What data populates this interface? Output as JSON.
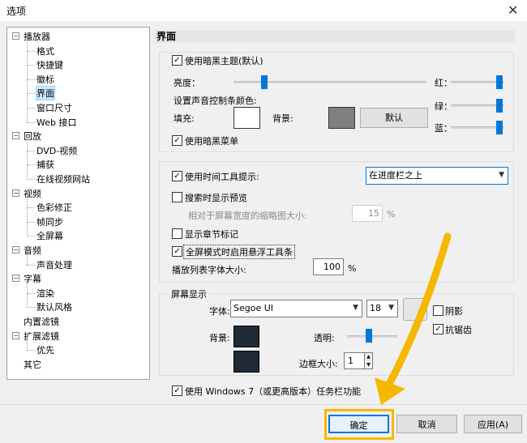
{
  "window": {
    "title": "选项",
    "close": "✕"
  },
  "tree": {
    "items": [
      {
        "label": "播放器",
        "level": 0,
        "expander": "−"
      },
      {
        "label": "格式",
        "level": 1
      },
      {
        "label": "快捷键",
        "level": 1
      },
      {
        "label": "徽标",
        "level": 1
      },
      {
        "label": "界面",
        "level": 1,
        "selected": true
      },
      {
        "label": "窗口尺寸",
        "level": 1
      },
      {
        "label": "Web 接口",
        "level": 1
      },
      {
        "label": "回放",
        "level": 0,
        "expander": "−"
      },
      {
        "label": "DVD-视频",
        "level": 1
      },
      {
        "label": "捕获",
        "level": 1
      },
      {
        "label": "在线视频网站",
        "level": 1
      },
      {
        "label": "视频",
        "level": 0,
        "expander": "−"
      },
      {
        "label": "色彩修正",
        "level": 1
      },
      {
        "label": "帧同步",
        "level": 1
      },
      {
        "label": "全屏幕",
        "level": 1
      },
      {
        "label": "音频",
        "level": 0,
        "expander": "−"
      },
      {
        "label": "声音处理",
        "level": 1
      },
      {
        "label": "字幕",
        "level": 0,
        "expander": "−"
      },
      {
        "label": "渲染",
        "level": 1
      },
      {
        "label": "默认风格",
        "level": 1
      },
      {
        "label": "内置滤镜",
        "level": 0
      },
      {
        "label": "扩展滤镜",
        "level": 0,
        "expander": "−"
      },
      {
        "label": "优先",
        "level": 1
      },
      {
        "label": "其它",
        "level": 0
      }
    ]
  },
  "panel": {
    "title": "界面",
    "theme": {
      "dark_theme_label": "使用暗黑主题(默认)",
      "dark_theme_checked": "✓",
      "brightness_label": "亮度：",
      "brightness_level": 0.16,
      "red_label": "红：",
      "green_label": "绿：",
      "blue_label": "蓝：",
      "red_level": 1.0,
      "green_level": 1.0,
      "blue_level": 1.0,
      "control_bar_color_label": "设置声音控制条颜色:",
      "fill_label": "填充:",
      "background_label": "背景:",
      "fill_color": "#ffffff",
      "background_color": "#808080",
      "default_button": "默认",
      "dark_menu_label": "使用暗黑菜单",
      "dark_menu_checked": "✓"
    },
    "tooltip": {
      "time_tooltip_label": "使用时间工具提示:",
      "time_tooltip_checked": "✓",
      "position_value": "在进度栏之上",
      "seek_preview_label": "搜索时显示预览",
      "thumb_size_label": "相对于屏幕宽度的缩略图大小:",
      "thumb_size_value": "15",
      "thumb_size_unit": "%",
      "chapter_marks_label": "显示章节标记",
      "floating_toolbar_label": "全屏模式时启用悬浮工具条",
      "floating_toolbar_checked": "✓",
      "playlist_font_label": "播放列表字体大小:",
      "playlist_font_value": "100",
      "playlist_font_unit": "%"
    },
    "osd": {
      "group_label": "屏幕显示",
      "font_label": "字体:",
      "font_value": "Segoe UI",
      "size_value": "18",
      "shadow_label": "阴影",
      "antialias_label": "抗锯齿",
      "antialias_checked": "✓",
      "background_label": "背景:",
      "transparency_label": "透明:",
      "transparency_level": 0.42,
      "border_label": "边框大小:",
      "border_value": "1",
      "swatch_color": "#1f2a36",
      "swatch_border": "#000000"
    },
    "win7_label": "使用 Windows 7（或更高版本）任务栏功能",
    "win7_checked": "✓"
  },
  "footer": {
    "ok_button": "确定",
    "cancel_button": "取消",
    "apply_button": "应用(A)",
    "highlight_color": "#f5b800"
  }
}
